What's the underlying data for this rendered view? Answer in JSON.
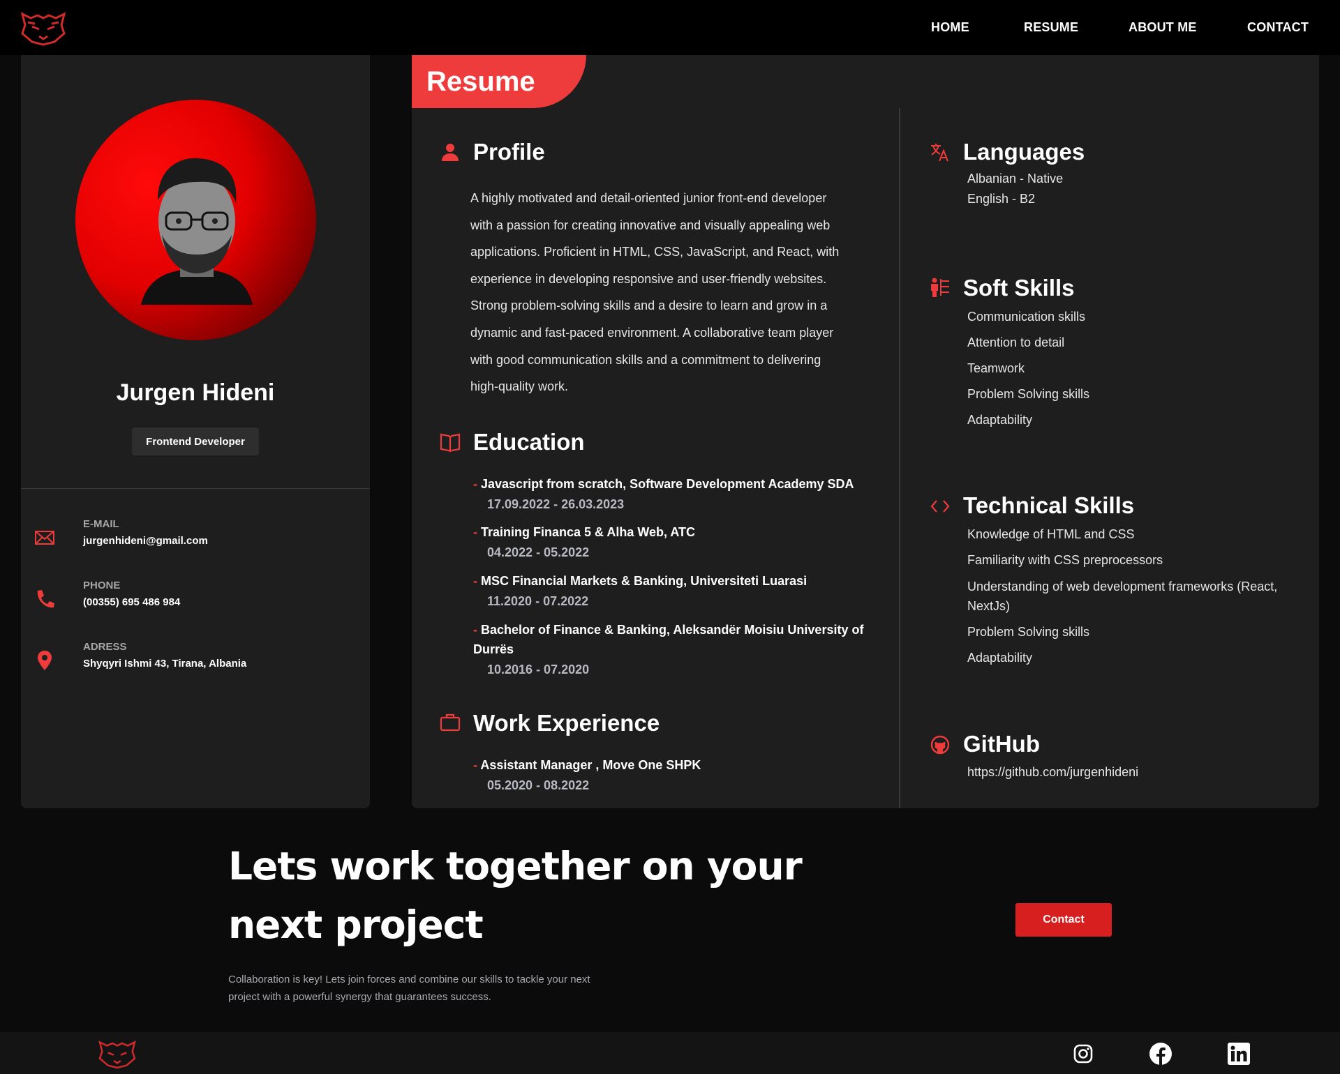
{
  "nav": {
    "logo_icon": "tiger-logo-icon",
    "items": [
      "HOME",
      "RESUME",
      "ABOUT ME",
      "CONTACT"
    ]
  },
  "sidebar": {
    "name": "Jurgen Hideni",
    "role": "Frontend Developer",
    "contacts": [
      {
        "label": "E-MAIL",
        "value": "jurgenhideni@gmail.com",
        "icon": "envelope-icon"
      },
      {
        "label": "PHONE",
        "value": "(00355) 695 486 984",
        "icon": "phone-icon"
      },
      {
        "label": "ADRESS",
        "value": "Shyqyri Ishmi 43, Tirana, Albania",
        "icon": "location-pin-icon"
      }
    ]
  },
  "main": {
    "tab": "Resume",
    "profile": {
      "title": "Profile",
      "text": "A highly motivated and detail-oriented junior front-end developer with a passion for creating innovative and visually appealing web applications. Proficient in HTML, CSS, JavaScript, and React, with experience in developing responsive and user-friendly websites. Strong problem-solving skills and a desire to learn and grow in a dynamic and fast-paced environment. A collaborative team player with good communication skills and a commitment to delivering high-quality work."
    },
    "education": {
      "title": "Education",
      "items": [
        {
          "title": "Javascript from scratch, Software Development Academy SDA",
          "dates": "17.09.2022 - 26.03.2023"
        },
        {
          "title": "Training Financa 5 & Alha Web, ATC",
          "dates": "04.2022 - 05.2022"
        },
        {
          "title": "MSC Financial Markets & Banking, Universiteti Luarasi",
          "dates": "11.2020 - 07.2022"
        },
        {
          "title": "Bachelor of Finance & Banking, Aleksandër Moisiu University of Durrës",
          "dates": "10.2016 - 07.2020"
        }
      ]
    },
    "work": {
      "title": "Work Experience",
      "items": [
        {
          "title": "Assistant Manager , Move One SHPK",
          "dates": "05.2020 - 08.2022"
        }
      ]
    },
    "languages": {
      "title": "Languages",
      "items": [
        "Albanian - Native",
        "English - B2"
      ]
    },
    "soft_skills": {
      "title": "Soft Skills",
      "items": [
        "Communication skills",
        "Attention to detail",
        "Teamwork",
        "Problem Solving skills",
        "Adaptability"
      ]
    },
    "technical_skills": {
      "title": "Technical Skills",
      "items": [
        "Knowledge of HTML and CSS",
        "Familiarity with CSS preprocessors",
        "Understanding of web development frameworks (React, NextJs)",
        "Problem Solving skills",
        "Adaptability"
      ]
    },
    "github": {
      "title": "GitHub",
      "url": "https://github.com/jurgenhideni"
    }
  },
  "cta": {
    "title_line1": "Lets work together on your",
    "title_line2": "next project",
    "text": "Collaboration is key! Lets join forces and combine our skills to tackle your next project with a powerful synergy that guarantees success.",
    "button": "Contact"
  },
  "footer": {
    "social_icons": [
      "instagram-icon",
      "facebook-icon",
      "linkedin-icon"
    ]
  },
  "colors": {
    "accent": "#ee3c3c",
    "card": "#1e1e1f",
    "background": "#0b0b0b",
    "nav": "#000000"
  }
}
